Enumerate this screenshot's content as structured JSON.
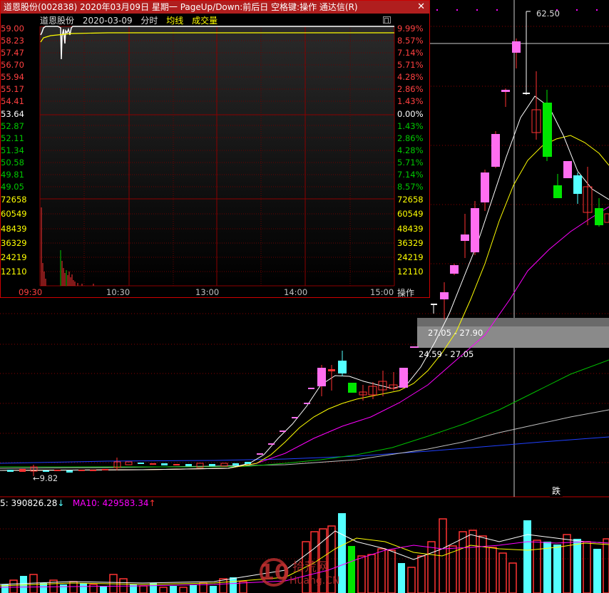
{
  "popup": {
    "title": "道恩股份(002838) 2020年03月09日 星期一 PageUp/Down:前后日 空格键:操作 通达信(R)",
    "close_glyph": "✕",
    "header": {
      "stock_name": "道恩股份",
      "date": "2020-03-09",
      "mode": "分时",
      "avg_line": "均线",
      "volume": "成交量"
    },
    "price_labels": [
      "59.00",
      "58.23",
      "57.47",
      "56.70",
      "55.94",
      "55.17",
      "54.41",
      "53.64",
      "52.87",
      "52.11",
      "51.34",
      "50.58",
      "49.81",
      "49.05"
    ],
    "pct_labels": [
      "9.99%",
      "8.57%",
      "7.14%",
      "5.71%",
      "4.28%",
      "2.86%",
      "1.43%",
      "0.00%",
      "1.43%",
      "2.86%",
      "4.28%",
      "5.71%",
      "7.14%",
      "8.57%"
    ],
    "volume_labels": [
      "72658",
      "60549",
      "48439",
      "36329",
      "24219",
      "12110"
    ],
    "time_labels": [
      "09:30",
      "10:30",
      "13:00",
      "14:00",
      "15:00"
    ],
    "op_button": "操作",
    "colors": {
      "up": "#ff4040",
      "down": "#00c800",
      "neutral": "#ffffff",
      "grid": "#8b0000",
      "avg": "#ffff00"
    }
  },
  "chart": {
    "high_label": "62.50",
    "low_label": "9.82",
    "low_arrow": "←",
    "tooltip1": "27.05 - 27.90",
    "tooltip2": "24.59 - 27.05",
    "die_button": "跌"
  },
  "indicator": {
    "ma5_text": "5: 390826.28",
    "ma5_arrow": "↓",
    "ma10_text": "MA10: 429583.34",
    "ma10_arrow": "↑"
  },
  "watermark": {
    "logo_text": "10",
    "site_name": "拾荒网",
    "site_domain": "Huang.CN"
  },
  "colors": {
    "magenta_candle": "#ff6ef0",
    "cyan_candle": "#54ffff",
    "green_candle": "#00e600",
    "red_outline": "#ff3232",
    "ma_white": "#ffffff",
    "ma_yellow": "#ffff00",
    "ma_magenta": "#ff00ff",
    "ma_green": "#00c000",
    "ma_gray": "#c0c0c0",
    "ma_blue": "#2040ff"
  }
}
